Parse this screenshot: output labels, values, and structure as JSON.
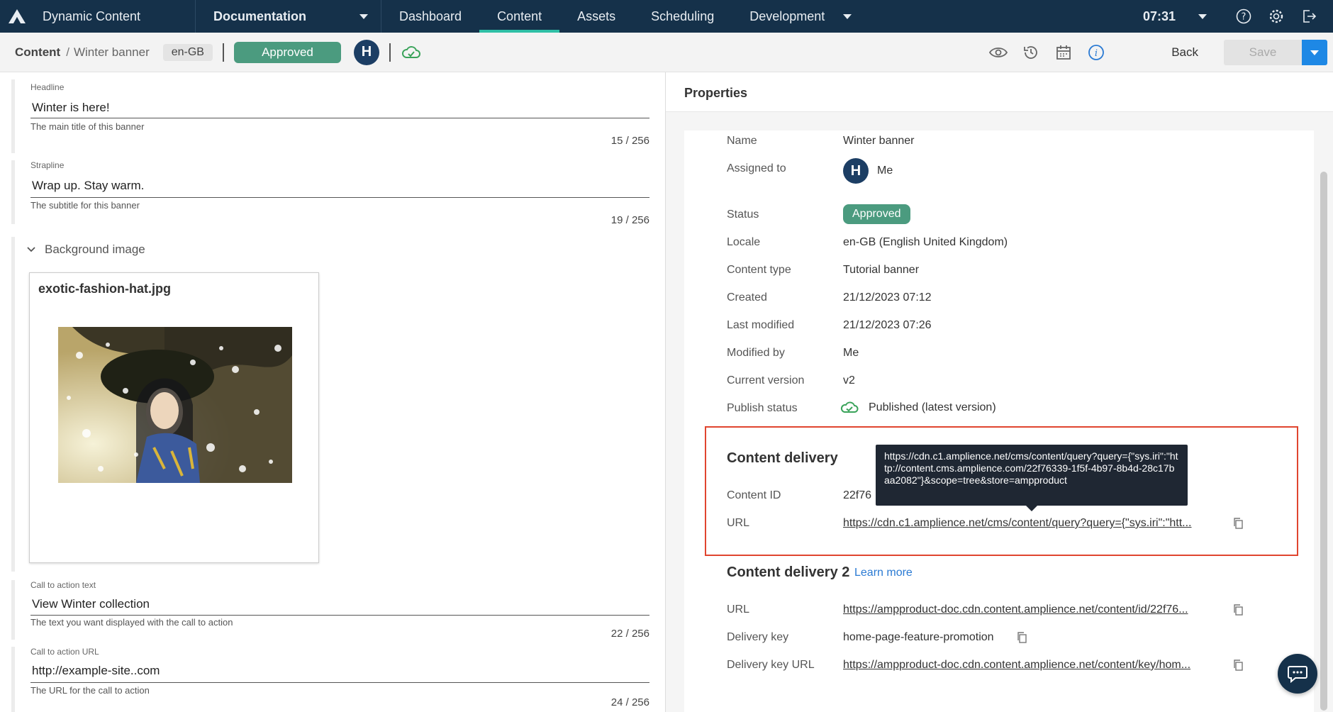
{
  "nav": {
    "app_name": "Dynamic Content",
    "hub": "Documentation",
    "tabs": [
      "Dashboard",
      "Content",
      "Assets",
      "Scheduling",
      "Development"
    ],
    "active_tab": "Content",
    "time": "07:31"
  },
  "toolbar": {
    "breadcrumb_root": "Content",
    "breadcrumb_sep": "/",
    "breadcrumb_leaf": "Winter banner",
    "locale": "en-GB",
    "status": "Approved",
    "avatar_initial": "H",
    "back_label": "Back",
    "save_label": "Save"
  },
  "editor": {
    "headline": {
      "label": "Headline",
      "value": "Winter is here!",
      "help": "The main title of this banner",
      "count": "15 / 256"
    },
    "strapline": {
      "label": "Strapline",
      "value": "Wrap up. Stay warm.",
      "help": "The subtitle for this banner",
      "count": "19 / 256"
    },
    "background": {
      "label": "Background image",
      "file": "exotic-fashion-hat.jpg"
    },
    "cta_text": {
      "label": "Call to action text",
      "value": "View Winter collection",
      "help": "The text you want displayed with the call to action",
      "count": "22 / 256"
    },
    "cta_url": {
      "label": "Call to action URL",
      "value": "http://example-site..com",
      "help": "The URL for the call to action",
      "count": "24 / 256"
    }
  },
  "properties": {
    "title": "Properties",
    "name_label": "Name",
    "name": "Winter banner",
    "assigned_label": "Assigned to",
    "assigned_initial": "H",
    "assigned": "Me",
    "status_label": "Status",
    "status": "Approved",
    "locale_label": "Locale",
    "locale": "en-GB (English United Kingdom)",
    "type_label": "Content type",
    "type": "Tutorial banner",
    "created_label": "Created",
    "created": "21/12/2023 07:12",
    "modified_label": "Last modified",
    "modified": "21/12/2023 07:26",
    "modified_by_label": "Modified by",
    "modified_by": "Me",
    "version_label": "Current version",
    "version": "v2",
    "publish_label": "Publish status",
    "publish": "Published (latest version)"
  },
  "delivery": {
    "title": "Content delivery",
    "id_label": "Content ID",
    "id_visible": "22f76",
    "url_label": "URL",
    "url": "https://cdn.c1.amplience.net/cms/content/query?query={\"sys.iri\":\"htt...",
    "tooltip": "https://cdn.c1.amplience.net/cms/content/query?query={\"sys.iri\":\"http://content.cms.amplience.com/22f76339-1f5f-4b97-8b4d-28c17baa2082\"}&scope=tree&store=ampproduct"
  },
  "delivery2": {
    "title": "Content delivery 2",
    "learn_more": "Learn more",
    "url_label": "URL",
    "url": "https://ampproduct-doc.cdn.content.amplience.net/content/id/22f76...",
    "key_label": "Delivery key",
    "key": "home-page-feature-promotion",
    "key_url_label": "Delivery key URL",
    "key_url": "https://ampproduct-doc.cdn.content.amplience.net/content/key/hom..."
  },
  "colors": {
    "nav_bg": "#15314a",
    "accent": "#2fbfa6",
    "approved": "#4b9b7f",
    "highlight_border": "#e0452f",
    "link_blue": "#2a7ad3"
  }
}
